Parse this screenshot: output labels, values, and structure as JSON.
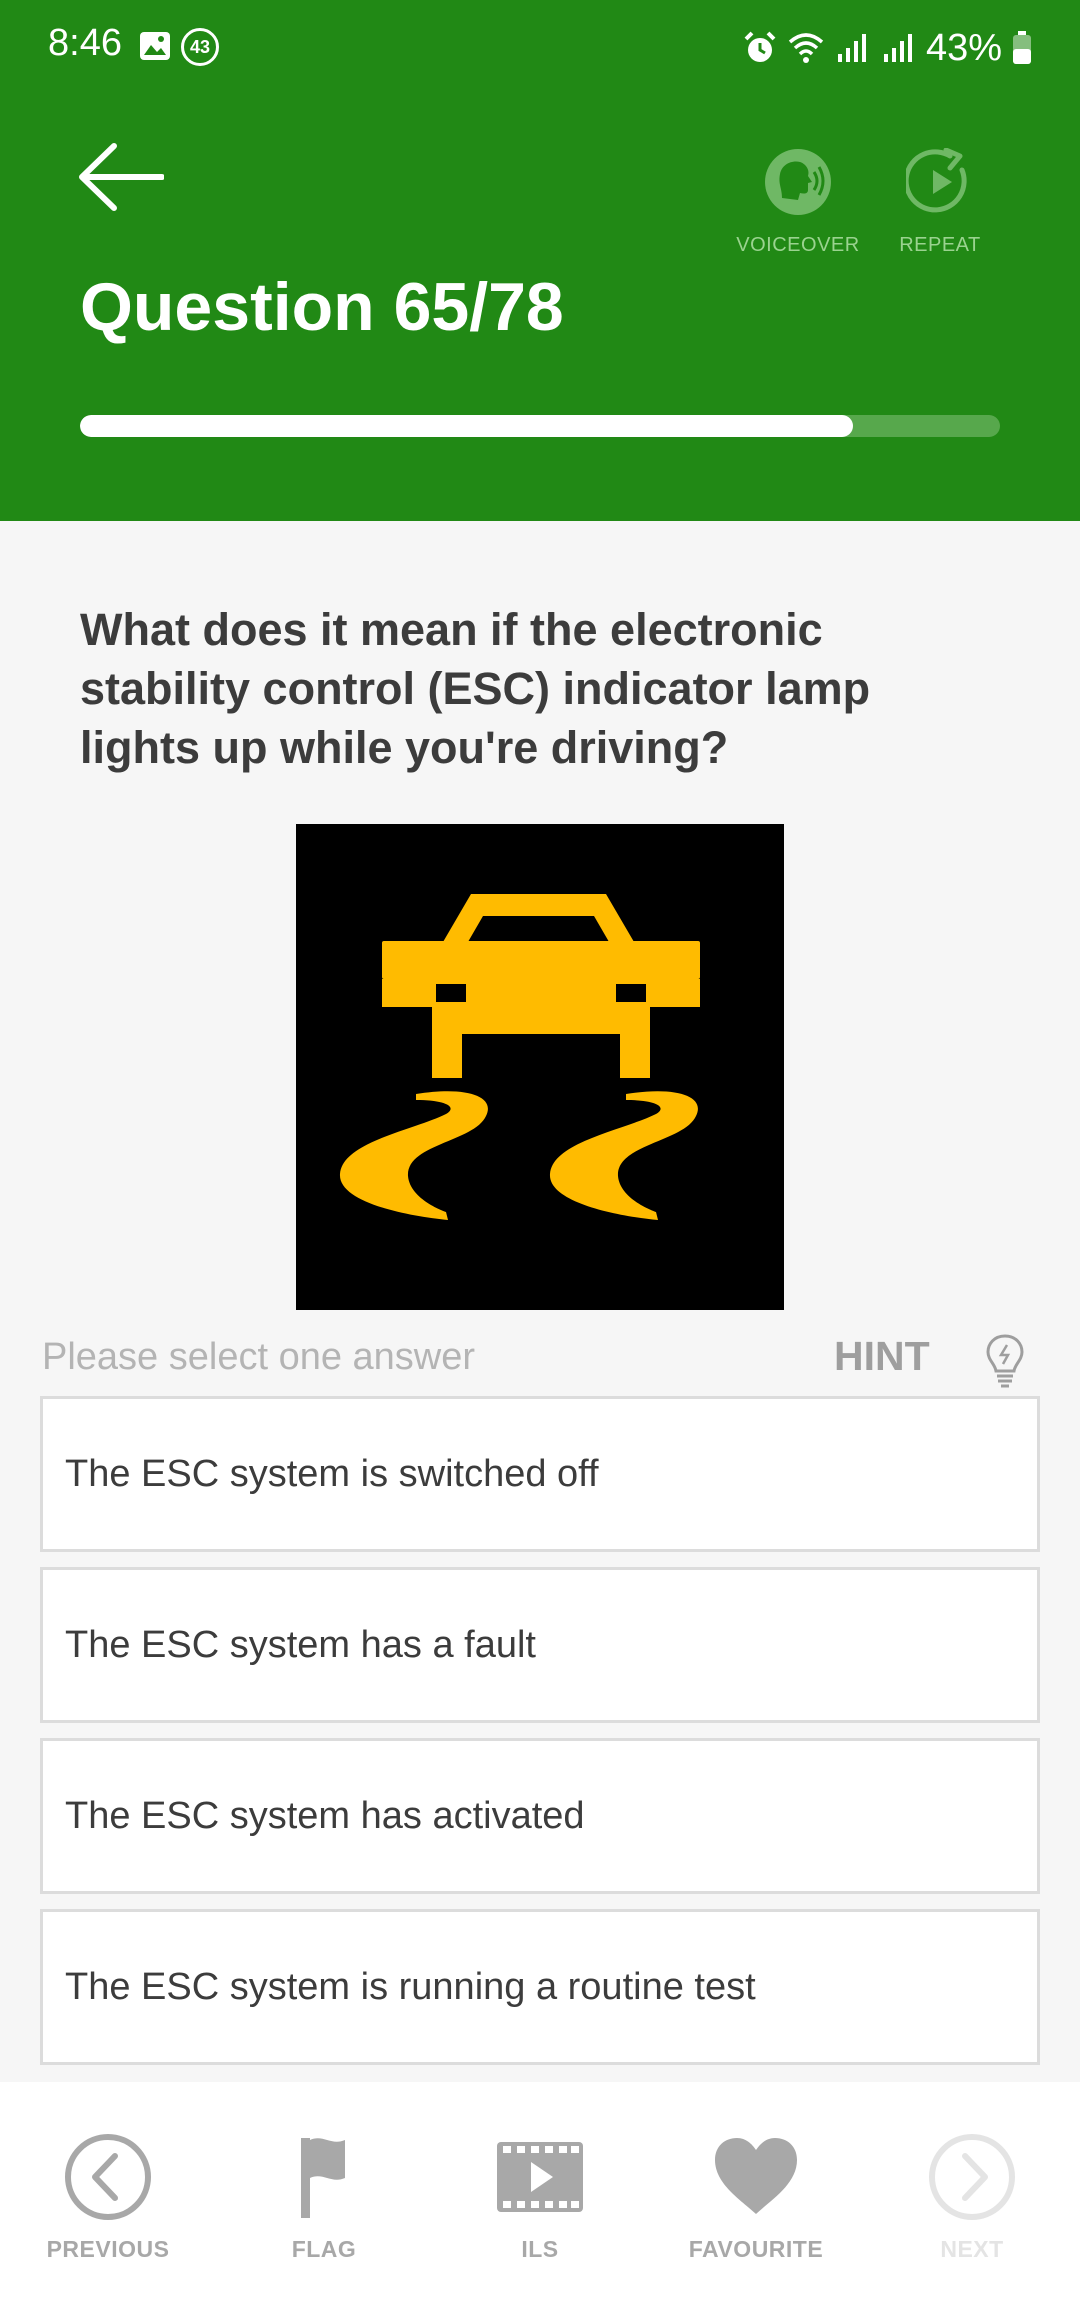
{
  "status_bar": {
    "time": "8:46",
    "notification_count": "43",
    "battery_percent": "43%",
    "icons": [
      "gallery-icon",
      "alarm-icon",
      "wifi-icon",
      "signal-icon",
      "signal-icon",
      "battery-icon"
    ]
  },
  "header": {
    "back_icon": "arrow-left-icon",
    "voiceover_label": "VOICEOVER",
    "repeat_label": "REPEAT",
    "title": "Question 65/78",
    "progress": 0.84,
    "colors": {
      "background": "#218915",
      "progress_fill": "#ffffff",
      "progress_track": "#57a84c"
    }
  },
  "question": {
    "text": "What does it mean if the electronic stability control (ESC) indicator lamp lights up while you're driving?",
    "image_icon": "esc-warning-lamp-icon"
  },
  "instructions": {
    "prompt": "Please select one answer",
    "hint_label": "HINT",
    "hint_icon": "lightbulb-icon"
  },
  "answers": [
    {
      "label": "The ESC system is switched off"
    },
    {
      "label": "The ESC system has a fault"
    },
    {
      "label": "The ESC system has activated"
    },
    {
      "label": "The ESC system is running a routine test"
    }
  ],
  "bottom_nav": {
    "previous_label": "PREVIOUS",
    "flag_label": "FLAG",
    "ils_label": "ILS",
    "favourite_label": "FAVOURITE",
    "next_label": "NEXT"
  }
}
